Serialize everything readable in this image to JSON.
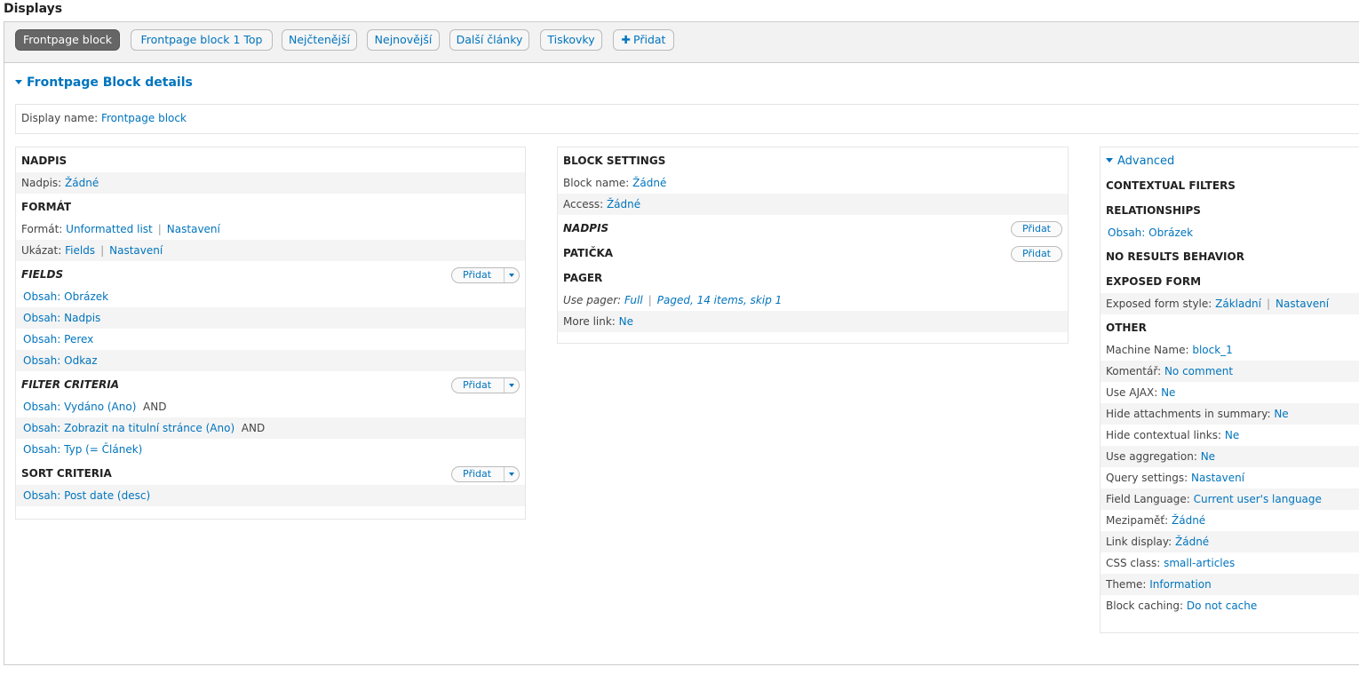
{
  "page": {
    "heading": "Displays"
  },
  "tabs": [
    {
      "label": "Frontpage block",
      "active": true
    },
    {
      "label": "Frontpage block 1 Top"
    },
    {
      "label": "Nejčtenější"
    },
    {
      "label": "Nejnovější"
    },
    {
      "label": "Další články"
    },
    {
      "label": "Tiskovky"
    },
    {
      "label": "Přidat",
      "icon": "plus-icon"
    }
  ],
  "details": {
    "title": "Frontpage Block details",
    "display_name_label": "Display name:",
    "display_name_value": "Frontpage block"
  },
  "left": {
    "nadpis": {
      "title": "NADPIS",
      "label": "Nadpis:",
      "value": "Žádné"
    },
    "format": {
      "title": "FORMÁT",
      "format_label": "Formát:",
      "format_value": "Unformatted list",
      "format_settings": "Nastavení",
      "show_label": "Ukázat:",
      "show_value": "Fields",
      "show_settings": "Nastavení"
    },
    "fields": {
      "title": "FIELDS",
      "add": "Přidat",
      "items": [
        "Obsah: Obrázek",
        "Obsah: Nadpis",
        "Obsah: Perex",
        "Obsah: Odkaz"
      ]
    },
    "filters": {
      "title": "FILTER CRITERIA",
      "add": "Přidat",
      "items": [
        {
          "link": "Obsah: Vydáno (Ano)",
          "op": "AND"
        },
        {
          "link": "Obsah: Zobrazit na titulní stránce (Ano)",
          "op": "AND"
        },
        {
          "link": "Obsah: Typ (= Článek)",
          "op": ""
        }
      ]
    },
    "sort": {
      "title": "SORT CRITERIA",
      "add": "Přidat",
      "items": [
        "Obsah: Post date (desc)"
      ]
    }
  },
  "middle": {
    "block_settings": {
      "title": "BLOCK SETTINGS",
      "name_label": "Block name:",
      "name_value": "Žádné",
      "access_label": "Access:",
      "access_value": "Žádné"
    },
    "nadpis": {
      "title": "NADPIS",
      "add": "Přidat"
    },
    "paticka": {
      "title": "PATIČKA",
      "add": "Přidat"
    },
    "pager": {
      "title": "PAGER",
      "use_label": "Use pager:",
      "use_value": "Full",
      "use_detail": "Paged, 14 items, skip 1",
      "more_label": "More link:",
      "more_value": "Ne"
    }
  },
  "right": {
    "advanced": "Advanced",
    "contextual": "CONTEXTUAL FILTERS",
    "relationships": {
      "title": "RELATIONSHIPS",
      "item": "Obsah: Obrázek"
    },
    "no_results": "NO RESULTS BEHAVIOR",
    "exposed": {
      "title": "EXPOSED FORM",
      "label": "Exposed form style:",
      "value": "Základní",
      "settings": "Nastavení"
    },
    "other": {
      "title": "OTHER",
      "rows": [
        {
          "label": "Machine Name:",
          "value": "block_1"
        },
        {
          "label": "Komentář:",
          "value": "No comment"
        },
        {
          "label": "Use AJAX:",
          "value": "Ne"
        },
        {
          "label": "Hide attachments in summary:",
          "value": "Ne"
        },
        {
          "label": "Hide contextual links:",
          "value": "Ne"
        },
        {
          "label": "Use aggregation:",
          "value": "Ne"
        },
        {
          "label": "Query settings:",
          "value": "Nastavení"
        },
        {
          "label": "Field Language:",
          "value": "Current user's language"
        },
        {
          "label": "Mezipaměť:",
          "value": "Žádné"
        },
        {
          "label": "Link display:",
          "value": "Žádné"
        },
        {
          "label": "CSS class:",
          "value": "small-articles"
        },
        {
          "label": "Theme:",
          "value": "Information"
        },
        {
          "label": "Block caching:",
          "value": "Do not cache"
        }
      ]
    }
  }
}
